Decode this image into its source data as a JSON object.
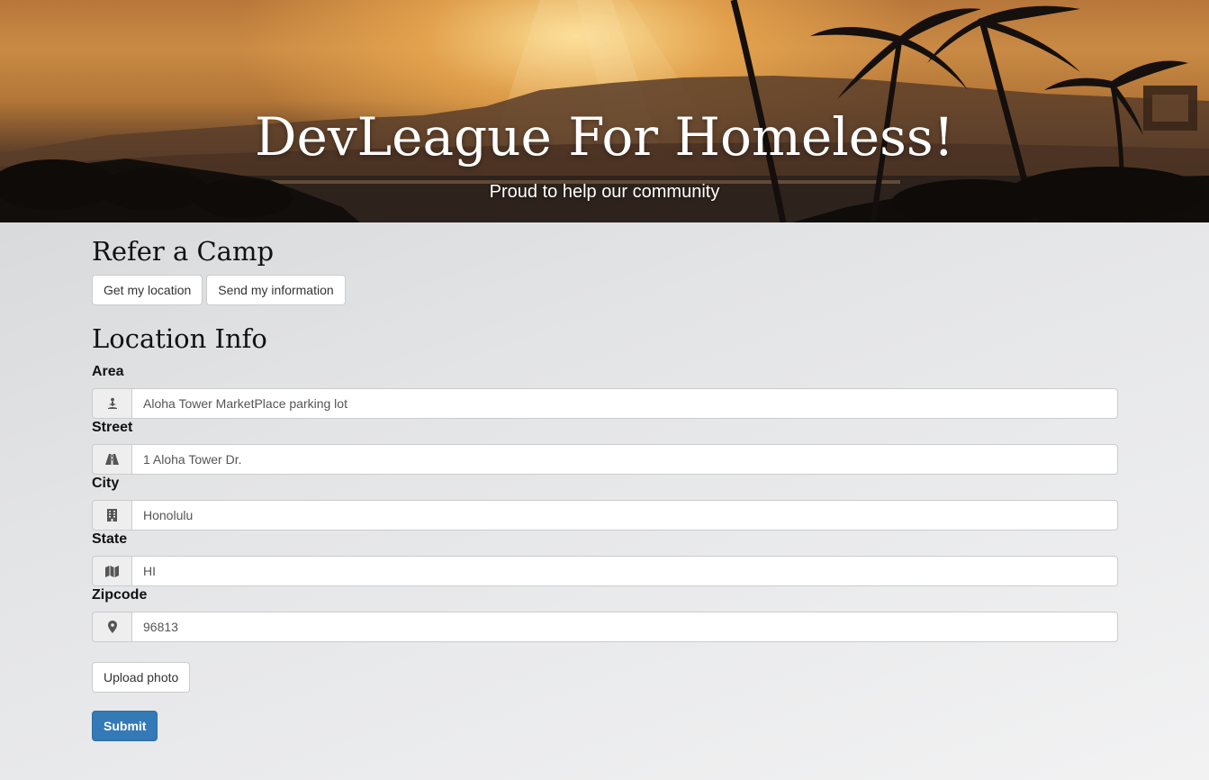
{
  "hero": {
    "title": "DevLeague For Homeless!",
    "subtitle": "Proud to help our community"
  },
  "refer": {
    "heading": "Refer a Camp",
    "get_location_label": "Get my location",
    "send_info_label": "Send my information"
  },
  "location": {
    "heading": "Location Info",
    "fields": [
      {
        "label": "Area",
        "value": "Aloha Tower MarketPlace parking lot",
        "icon": "person-icon"
      },
      {
        "label": "Street",
        "value": "1 Aloha Tower Dr.",
        "icon": "road-icon"
      },
      {
        "label": "City",
        "value": "Honolulu",
        "icon": "building-icon"
      },
      {
        "label": "State",
        "value": "HI",
        "icon": "map-icon"
      },
      {
        "label": "Zipcode",
        "value": "96813",
        "icon": "map-marker-icon"
      }
    ]
  },
  "upload_label": "Upload photo",
  "submit_label": "Submit",
  "colors": {
    "primary": "#337ab7",
    "addon_bg": "#eeeeee",
    "border": "#cccccc"
  }
}
